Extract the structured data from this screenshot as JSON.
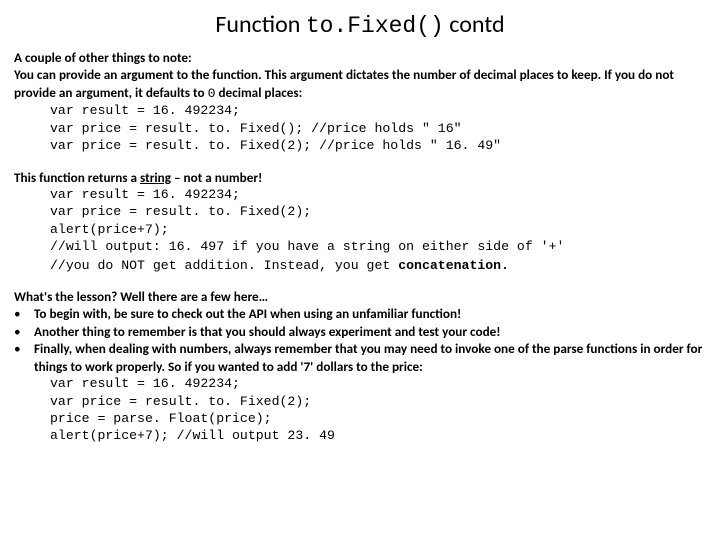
{
  "title_pre": "Function ",
  "title_code": "to.Fixed()",
  "title_post": " contd",
  "s1_intro": "A couple of other things to note:",
  "s1_l1a": "You can provide an argument to the function. This argument dictates the number of decimal places to keep. If you do not provide an argument, it defaults to ",
  "s1_l1b": "0",
  "s1_l1c": " decimal places:",
  "s1_code1": "var result = 16. 492234;",
  "s1_code2": "var price = result. to. Fixed();  //price holds \" 16\"",
  "s1_code3": "var price = result. to. Fixed(2); //price holds \" 16. 49\"",
  "s2_l1a": "This function returns a ",
  "s2_l1b": "string",
  "s2_l1c": " – not a number!",
  "s2_code1": "var result = 16. 492234;",
  "s2_code2": "var price = result. to. Fixed(2);",
  "s2_code3": "alert(price+7);",
  "s2_code4": "//will output:  16. 497 if you have a string on either side of '+'",
  "s2_code5a": "//you do NOT get addition. Instead, you get ",
  "s2_code5b": "concatenation.",
  "s3_head": "What's the lesson? Well there are a few here…",
  "s3_b1": "To begin with, be sure to check out the API when using an unfamiliar function!",
  "s3_b2": "Another thing to remember is that you should always experiment and test your code!",
  "s3_b3": "Finally, when dealing with numbers, always remember that you may need to invoke one of the parse functions in order for things to work properly. So if you wanted to add '7' dollars to the price:",
  "s3_code1": "var result = 16. 492234;",
  "s3_code2": "var price = result. to. Fixed(2);",
  "s3_code3": "price = parse. Float(price);",
  "s3_code4": "alert(price+7);   //will output 23. 49",
  "bullet": "•"
}
